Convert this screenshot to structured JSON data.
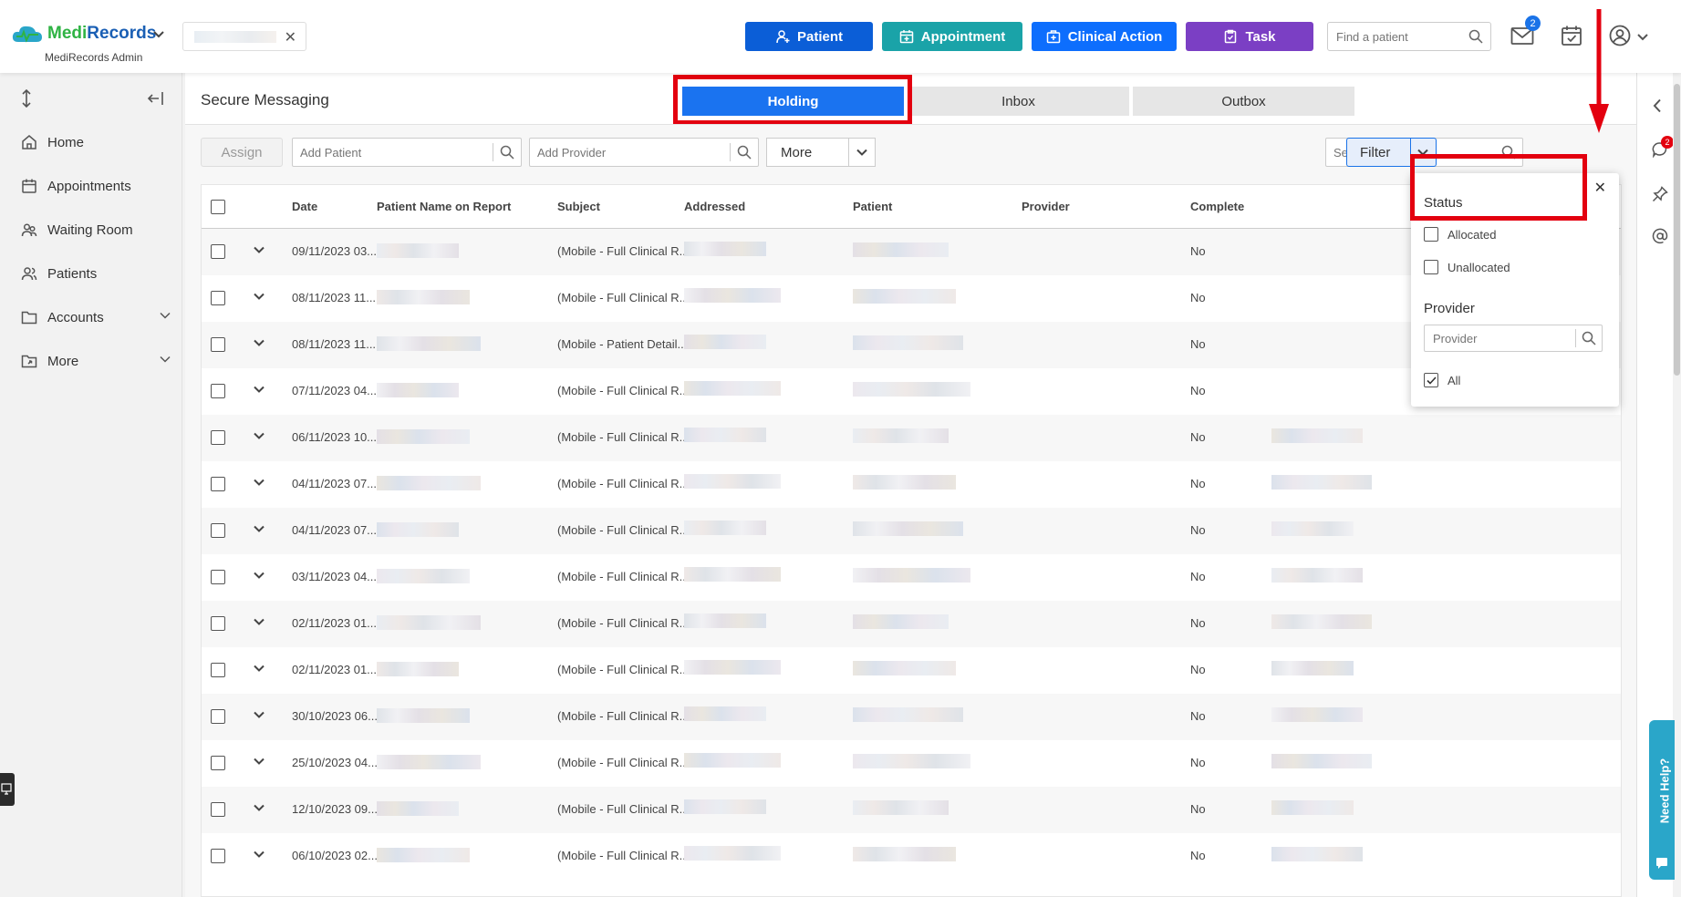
{
  "app": {
    "brand_a": "Medi",
    "brand_b": "Records",
    "subtitle": "MediRecords Admin"
  },
  "topbar": {
    "buttons": [
      {
        "label": "Patient",
        "icon": "add-user-icon",
        "color": "#0b5ed7"
      },
      {
        "label": "Appointment",
        "icon": "calendar-plus-icon",
        "color": "#1aa3a8"
      },
      {
        "label": "Clinical Action",
        "icon": "medical-case-icon",
        "color": "#0d6efd"
      },
      {
        "label": "Task",
        "icon": "clipboard-icon",
        "color": "#7b3fc4"
      }
    ],
    "find_placeholder": "Find a patient",
    "mail_badge": "2"
  },
  "sidebar": {
    "items": [
      {
        "label": "Home",
        "icon": "home-icon"
      },
      {
        "label": "Appointments",
        "icon": "calendar-icon"
      },
      {
        "label": "Waiting Room",
        "icon": "users-icon"
      },
      {
        "label": "Patients",
        "icon": "user-group-icon"
      },
      {
        "label": "Accounts",
        "icon": "folder-icon",
        "expandable": true
      },
      {
        "label": "More",
        "icon": "folder-share-icon",
        "expandable": true
      }
    ]
  },
  "main": {
    "title": "Secure Messaging",
    "tabs": [
      {
        "label": "Holding",
        "active": true
      },
      {
        "label": "Inbox",
        "active": false
      },
      {
        "label": "Outbox",
        "active": false
      }
    ],
    "toolbar": {
      "assign_label": "Assign",
      "add_patient_placeholder": "Add Patient",
      "add_provider_placeholder": "Add Provider",
      "more_label": "More",
      "search_placeholder": "Search",
      "filter_label": "Filter"
    },
    "table": {
      "columns": [
        "Date",
        "Patient Name on Report",
        "Subject",
        "Addressed",
        "Patient",
        "Provider",
        "Complete"
      ],
      "rows": [
        {
          "date": "09/11/2023 03...",
          "subject": "(Mobile - Full Clinical R...",
          "complete": "No"
        },
        {
          "date": "08/11/2023 11...",
          "subject": "(Mobile - Full Clinical R...",
          "complete": "No"
        },
        {
          "date": "08/11/2023 11...",
          "subject": "(Mobile - Patient Detail...",
          "complete": "No"
        },
        {
          "date": "07/11/2023 04...",
          "subject": "(Mobile - Full Clinical R...",
          "complete": "No"
        },
        {
          "date": "06/11/2023 10...",
          "subject": "(Mobile - Full Clinical R...",
          "complete": "No"
        },
        {
          "date": "04/11/2023 07...",
          "subject": "(Mobile - Full Clinical R...",
          "complete": "No"
        },
        {
          "date": "04/11/2023 07...",
          "subject": "(Mobile - Full Clinical R...",
          "complete": "No"
        },
        {
          "date": "03/11/2023 04...",
          "subject": "(Mobile - Full Clinical R...",
          "complete": "No"
        },
        {
          "date": "02/11/2023 01...",
          "subject": "(Mobile - Full Clinical R...",
          "complete": "No"
        },
        {
          "date": "02/11/2023 01...",
          "subject": "(Mobile - Full Clinical R...",
          "complete": "No"
        },
        {
          "date": "30/10/2023 06...",
          "subject": "(Mobile - Full Clinical R...",
          "complete": "No"
        },
        {
          "date": "25/10/2023 04...",
          "subject": "(Mobile - Full Clinical R...",
          "complete": "No"
        },
        {
          "date": "12/10/2023 09...",
          "subject": "(Mobile - Full Clinical R...",
          "complete": "No"
        },
        {
          "date": "06/10/2023 02...",
          "subject": "(Mobile - Full Clinical R...",
          "complete": "No"
        }
      ]
    },
    "filter_popup": {
      "status_heading": "Status",
      "status_options": [
        {
          "label": "Allocated",
          "checked": false
        },
        {
          "label": "Unallocated",
          "checked": false
        }
      ],
      "provider_heading": "Provider",
      "provider_placeholder": "Provider",
      "all_label": "All",
      "all_checked": true
    }
  },
  "rail": {
    "chat_badge": "2",
    "help_label": "Need Help?"
  },
  "colors": {
    "accent": "#1a73f0",
    "highlight": "#e3000f"
  }
}
